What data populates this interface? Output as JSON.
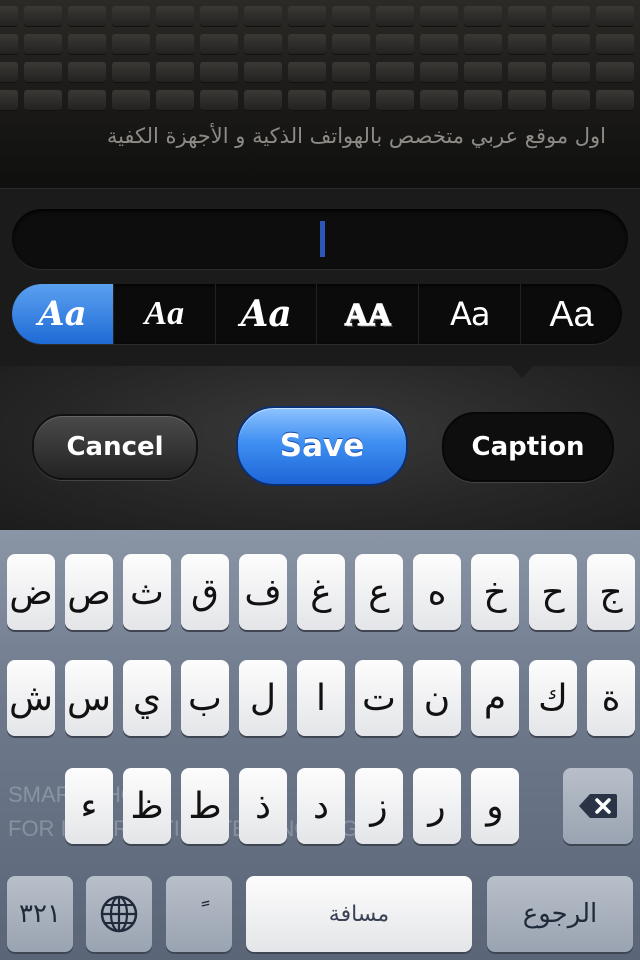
{
  "photo": {
    "caption": "اول موقع عربي متخصص بالهواتف الذكية و الأجهزة الكفية"
  },
  "editor": {
    "text_value": "",
    "font_options": [
      "Aa",
      "Aa",
      "Aa",
      "AA",
      "Aa",
      "Aa"
    ],
    "selected_font_index": 0
  },
  "actions": {
    "cancel": "Cancel",
    "save": "Save",
    "caption": "Caption"
  },
  "watermark": {
    "line1": "SMART PHONE",
    "line2": "FOR INFORMATION TECHNOLOGY"
  },
  "keyboard": {
    "row1": [
      "ض",
      "ص",
      "ث",
      "ق",
      "ف",
      "غ",
      "ع",
      "ه",
      "خ",
      "ح",
      "ج"
    ],
    "row2": [
      "ش",
      "س",
      "ي",
      "ب",
      "ل",
      "ا",
      "ت",
      "ن",
      "م",
      "ك",
      "ة"
    ],
    "row3": [
      "ء",
      "ظ",
      "ط",
      "ذ",
      "د",
      "ز",
      "ر",
      "و"
    ],
    "numbers_key": "٣٢١",
    "diacritic_key": "ً",
    "space_key": "مسافة",
    "return_key": "الرجوع",
    "accent_color": "#1f6bd6"
  }
}
